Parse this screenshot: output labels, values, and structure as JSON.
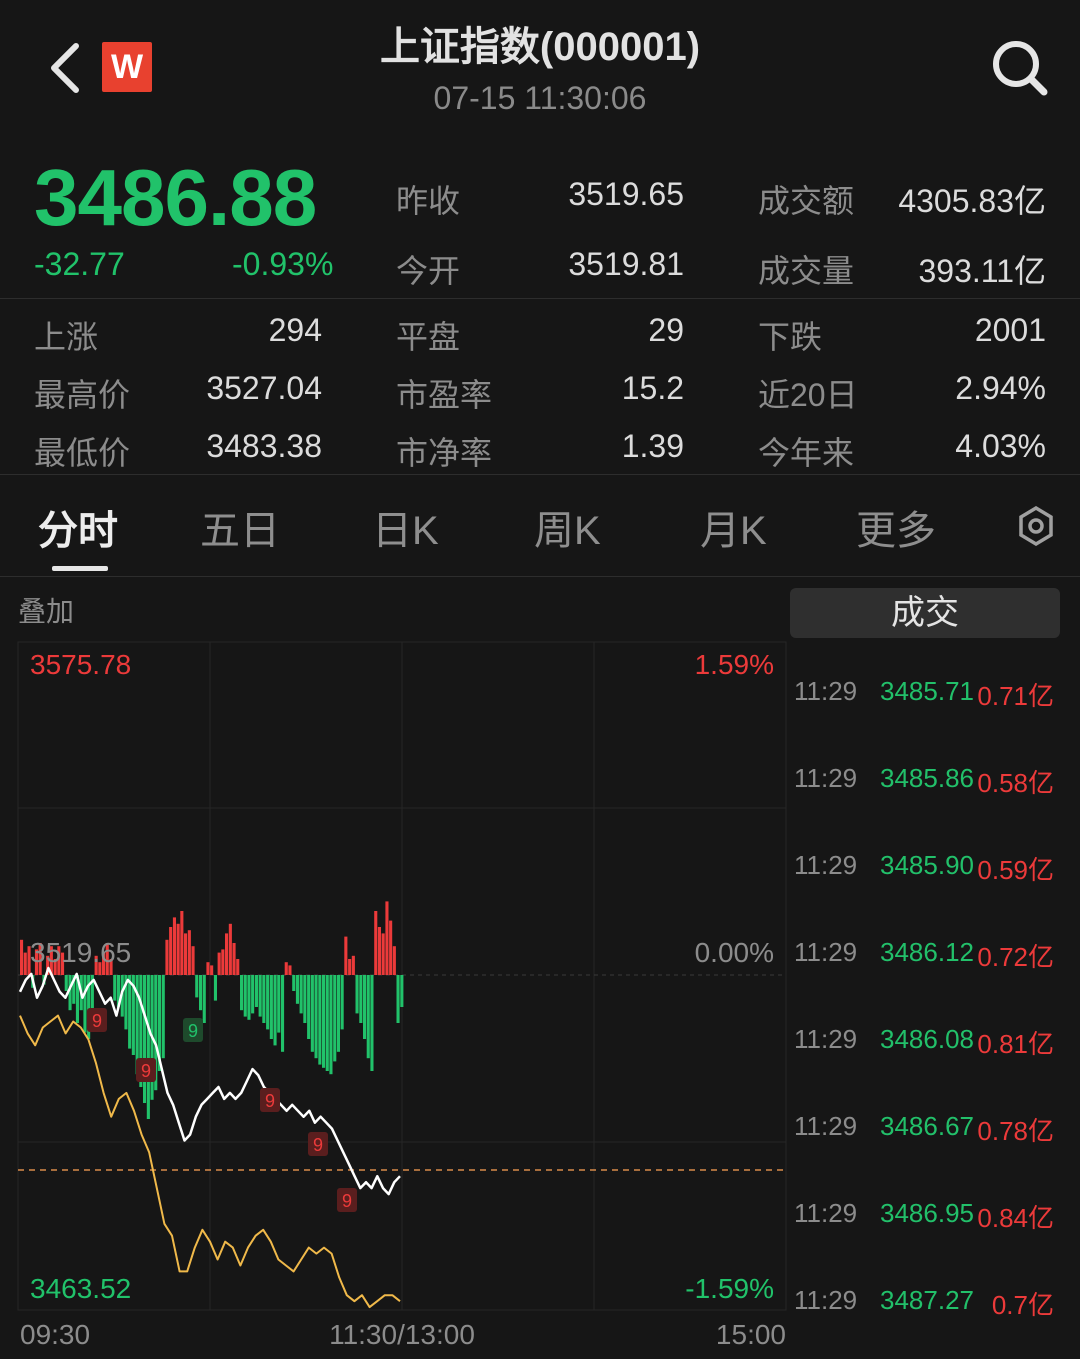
{
  "header": {
    "title": "上证指数(000001)",
    "datetime": "07-15 11:30:06",
    "logo_letter": "W",
    "back_icon": "chevron-left-icon",
    "search_icon": "search-icon"
  },
  "quote": {
    "price": "3486.88",
    "change": "-32.77",
    "change_pct": "-0.93%",
    "stats": [
      {
        "label": "昨收",
        "value": "3519.65"
      },
      {
        "label": "成交额",
        "value": "4305.83亿"
      },
      {
        "label": "今开",
        "value": "3519.81"
      },
      {
        "label": "成交量",
        "value": "393.11亿"
      }
    ],
    "grid": [
      {
        "label": "上涨",
        "value": "294"
      },
      {
        "label": "平盘",
        "value": "29"
      },
      {
        "label": "下跌",
        "value": "2001"
      },
      {
        "label": "最高价",
        "value": "3527.04"
      },
      {
        "label": "市盈率",
        "value": "15.2"
      },
      {
        "label": "近20日",
        "value": "2.94%"
      },
      {
        "label": "最低价",
        "value": "3483.38"
      },
      {
        "label": "市净率",
        "value": "1.39"
      },
      {
        "label": "今年来",
        "value": "4.03%"
      }
    ]
  },
  "tabs": [
    "分时",
    "五日",
    "日K",
    "周K",
    "月K",
    "更多"
  ],
  "active_tab": "分时",
  "overlay_label": "叠加",
  "deal_button": "成交",
  "colors": {
    "up": "#ec3a3a",
    "down": "#21c26a",
    "line": "#ffffff",
    "avg": "#f0b94a",
    "bg": "#161616"
  },
  "chart_data": {
    "type": "line",
    "max_label": "3575.78",
    "min_label": "3463.52",
    "max_pct": "1.59%",
    "min_pct": "-1.59%",
    "zero_pct": "0.00%",
    "prev_close": "3519.65",
    "x_ticks": [
      "09:30",
      "11:30/13:00",
      "15:00"
    ],
    "ylim": [
      3463.52,
      3575.78
    ],
    "price_series": [
      3517,
      3519,
      3520,
      3516,
      3518,
      3521,
      3519,
      3517,
      3516,
      3518,
      3520,
      3516,
      3518,
      3519,
      3517,
      3515,
      3516,
      3513,
      3517,
      3519,
      3518,
      3516,
      3513,
      3510,
      3508,
      3504,
      3500,
      3498,
      3495,
      3492,
      3493,
      3496,
      3498,
      3499,
      3500,
      3501,
      3499,
      3500,
      3499,
      3500,
      3502,
      3504,
      3503,
      3501,
      3500,
      3499,
      3498,
      3497,
      3498,
      3497,
      3496,
      3497,
      3495,
      3496,
      3495,
      3494,
      3492,
      3490,
      3488,
      3486,
      3484,
      3485,
      3484,
      3486,
      3484,
      3483,
      3485,
      3486
    ],
    "avg_series": [
      3513,
      3510,
      3508,
      3511,
      3512,
      3513,
      3510,
      3512,
      3511,
      3509,
      3505,
      3500,
      3496,
      3499,
      3500,
      3497,
      3493,
      3490,
      3484,
      3478,
      3476,
      3470,
      3470,
      3474,
      3477,
      3475,
      3472,
      3475,
      3474,
      3471,
      3474,
      3476,
      3477,
      3475,
      3472,
      3471,
      3470,
      3472,
      3474,
      3473,
      3474,
      3473,
      3469,
      3466,
      3465,
      3466,
      3464,
      3465,
      3466,
      3466,
      3465
    ],
    "volume_bars": [
      22,
      14,
      18,
      -8,
      16,
      20,
      -6,
      12,
      18,
      10,
      18,
      14,
      -10,
      -22,
      -18,
      -30,
      -22,
      -36,
      -40,
      -28,
      12,
      8,
      14,
      20,
      10,
      -16,
      -20,
      -26,
      -34,
      -46,
      -50,
      -62,
      -70,
      -80,
      -90,
      -78,
      -72,
      -60,
      -52,
      22,
      30,
      36,
      32,
      40,
      26,
      28,
      18,
      -14,
      -22,
      -30,
      8,
      6,
      -16,
      14,
      16,
      26,
      32,
      20,
      10,
      -22,
      -26,
      -28,
      -24,
      -20,
      -26,
      -30,
      -34,
      -40,
      -44,
      -36,
      -48,
      8,
      6,
      -10,
      -18,
      -24,
      -30,
      -40,
      -48,
      -52,
      -56,
      -58,
      -60,
      -62,
      -54,
      -48,
      -34,
      24,
      10,
      12,
      -24,
      -30,
      -40,
      -52,
      -60,
      40,
      30,
      26,
      46,
      34,
      18,
      -30,
      -20
    ]
  },
  "trades": [
    {
      "time": "11:29",
      "price": "3485.71",
      "volume": "0.71亿"
    },
    {
      "time": "11:29",
      "price": "3485.86",
      "volume": "0.58亿"
    },
    {
      "time": "11:29",
      "price": "3485.90",
      "volume": "0.59亿"
    },
    {
      "time": "11:29",
      "price": "3486.12",
      "volume": "0.72亿"
    },
    {
      "time": "11:29",
      "price": "3486.08",
      "volume": "0.81亿"
    },
    {
      "time": "11:29",
      "price": "3486.67",
      "volume": "0.78亿"
    },
    {
      "time": "11:29",
      "price": "3486.95",
      "volume": "0.84亿"
    },
    {
      "time": "11:29",
      "price": "3487.27",
      "volume": "0.7亿"
    }
  ]
}
